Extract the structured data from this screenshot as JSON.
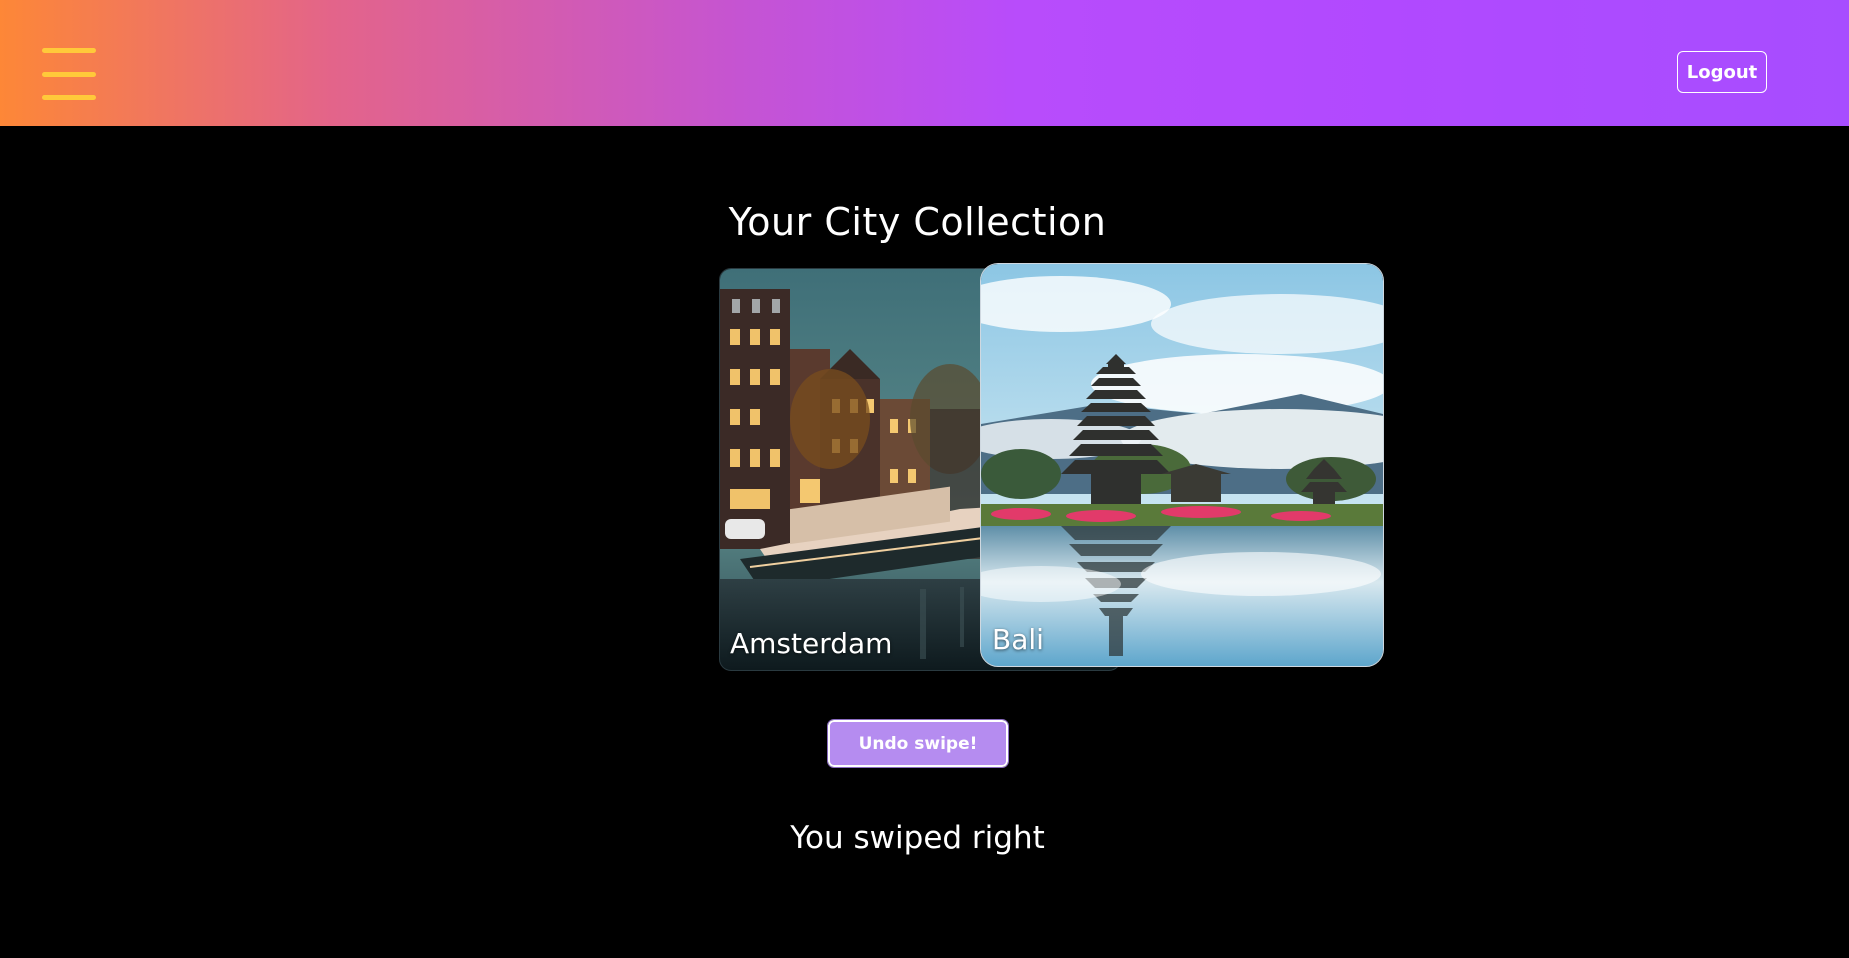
{
  "header": {
    "menu_icon": "hamburger-menu-icon",
    "logout_label": "Logout",
    "gradient_colors": [
      "#fd8737",
      "#c554d2",
      "#b149ff"
    ],
    "menu_icon_color": "#ffc93a"
  },
  "main": {
    "title": "Your City Collection",
    "cards": [
      {
        "name": "Amsterdam",
        "image": "amsterdam-canal-photo"
      },
      {
        "name": "Bali",
        "image": "bali-temple-photo"
      }
    ],
    "undo_label": "Undo swipe!",
    "undo_color": "#b58cf0",
    "status_text": "You swiped right"
  }
}
